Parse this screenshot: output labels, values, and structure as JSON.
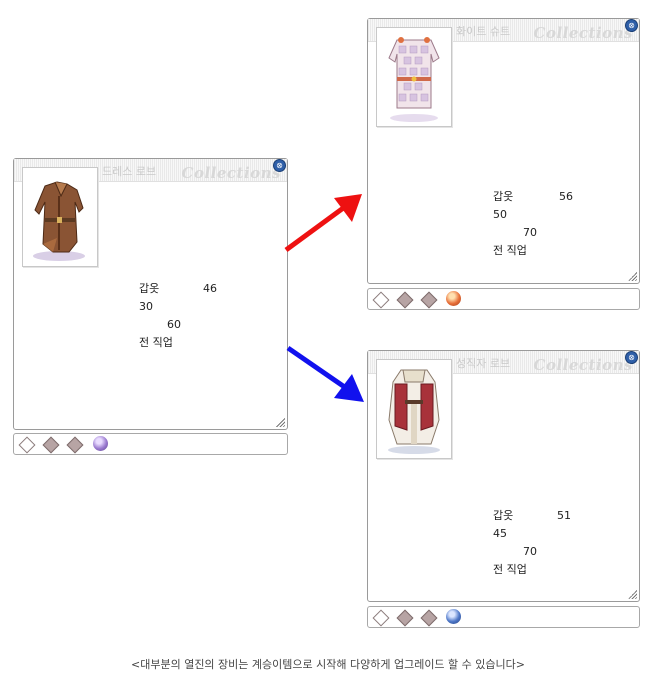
{
  "windows": [
    {
      "id": "base",
      "title": "드레스 로브",
      "watermark": "Collections",
      "close_symbol": "⊗",
      "stats": [
        "갑옷",
        "46",
        "30",
        "60",
        "전 직업"
      ],
      "slot_count": 3,
      "card_color": "#9b7bd0"
    },
    {
      "id": "upgrade_a",
      "title": "화이트 슈트",
      "watermark": "Collections",
      "close_symbol": "⊗",
      "stats": [
        "갑옷",
        "56",
        "50",
        "70",
        "전 직업"
      ],
      "slot_count": 3,
      "card_color": "#e8703a"
    },
    {
      "id": "upgrade_b",
      "title": "성직자 로브",
      "watermark": "Collections",
      "close_symbol": "⊗",
      "stats": [
        "갑옷",
        "51",
        "45",
        "70",
        "전 직업"
      ],
      "slot_count": 3,
      "card_color": "#4f78c8"
    }
  ],
  "arrows": [
    {
      "name": "red",
      "color": "#ee1111"
    },
    {
      "name": "blue",
      "color": "#1111ee"
    }
  ],
  "caption": "<대부분의 열진의 장비는 계승이템으로 시작해 다양하게 업그레이드 할 수 있습니다>"
}
